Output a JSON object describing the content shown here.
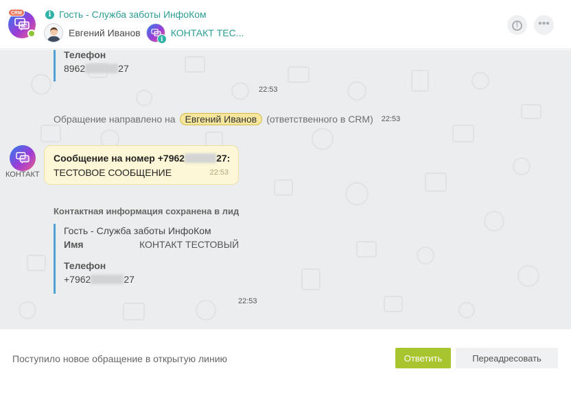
{
  "header": {
    "title": "Гость - Служба заботы ИнфоКом",
    "crm_badge": "CRM",
    "operator_name": "Евгений Иванов",
    "contact_link": "КОНТАКТ ТЕС...",
    "info_glyph": "i"
  },
  "chat": {
    "first_card": {
      "phone_label": "Телефон",
      "phone_prefix": "8962",
      "phone_suffix": "27",
      "time": "22:53"
    },
    "system_message": {
      "prefix": "Обращение направлено на",
      "mention": "Евгений Иванов",
      "suffix": "(ответственного в CRM)",
      "time": "22:53"
    },
    "contact_message": {
      "sender_label": "КОНТАКТ",
      "title_prefix": "Сообщение на номер +7962",
      "title_suffix": "27:",
      "text": "ТЕСТОВОЕ СООБЩЕНИЕ",
      "time": "22:53"
    },
    "saved_info": {
      "title": "Контактная информация сохранена в лид",
      "source": "Гость - Служба заботы ИнфоКом",
      "name_label": "Имя",
      "name_value": "КОНТАКТ ТЕСТОВЫЙ",
      "phone_label": "Телефон",
      "phone_prefix": "+7962",
      "phone_suffix": "27",
      "time": "22:53"
    }
  },
  "footer": {
    "status_text": "Поступило новое обращение в открытую линию",
    "answer_button": "Ответить",
    "forward_button": "Переадресовать"
  },
  "icons": {
    "chat_avatar": "chat-bubbles-icon",
    "info": "info-icon",
    "alert": "alert-circle-icon",
    "more": "more-dots-icon"
  },
  "colors": {
    "accent_teal": "#2a9d94",
    "answer_green": "#a8c52f",
    "mention_yellow": "#f7e79c",
    "bubble_bg": "#fdf7d7",
    "quote_bar": "#4fa0d4"
  }
}
